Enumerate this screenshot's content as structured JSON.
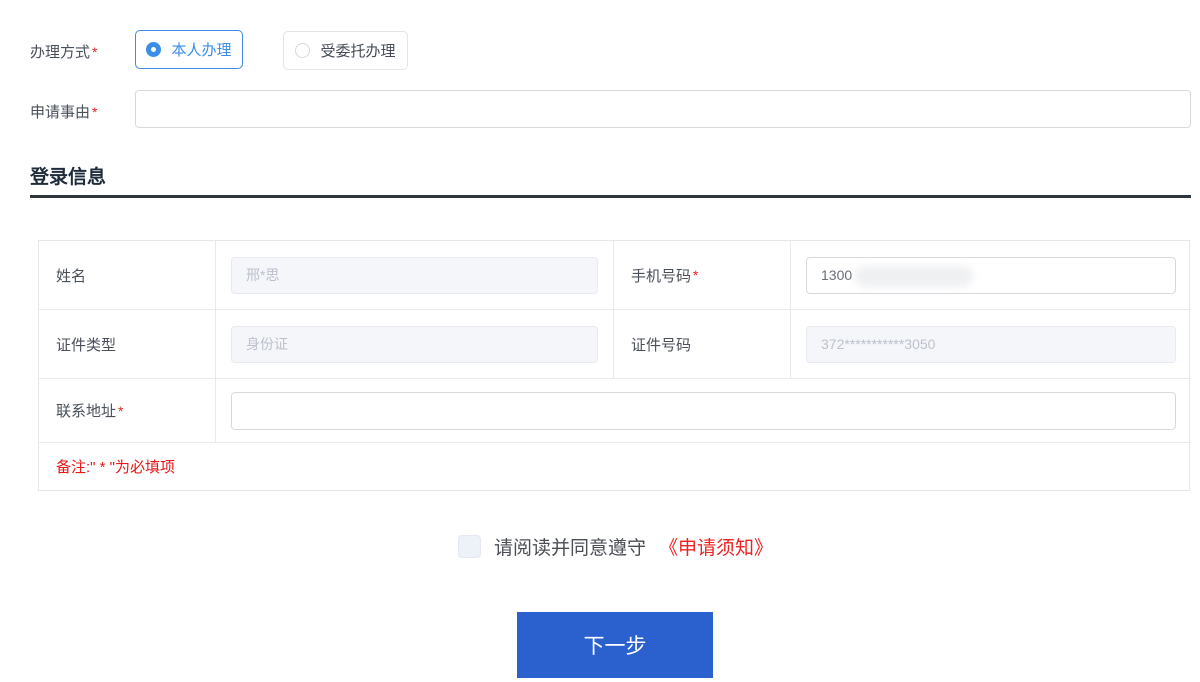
{
  "colors": {
    "accent_blue": "#3a8ee6",
    "button_blue": "#2b61ce",
    "required_red": "#ed1f1f",
    "note_red": "#e81717",
    "heading_dark": "#1f2b3a"
  },
  "method": {
    "label": "办理方式",
    "required_mark": "*",
    "options": [
      {
        "label": "本人办理",
        "selected": true
      },
      {
        "label": "受委托办理",
        "selected": false
      }
    ]
  },
  "reason": {
    "label": "申请事由",
    "required_mark": "*",
    "value": "",
    "placeholder": ""
  },
  "section": {
    "title": "登录信息"
  },
  "info_table": {
    "name": {
      "label": "姓名",
      "value": "邢*思"
    },
    "phone": {
      "label": "手机号码",
      "required_mark": "*",
      "value": "1300"
    },
    "id_type": {
      "label": "证件类型",
      "value": "身份证"
    },
    "id_number": {
      "label": "证件号码",
      "value": "372***********3050"
    },
    "address": {
      "label": "联系地址",
      "required_mark": "*",
      "value": "",
      "placeholder": ""
    },
    "note": "备注:\" * \"为必填项"
  },
  "agreement": {
    "text": "请阅读并同意遵守",
    "link": "《申请须知》",
    "checked": false
  },
  "next_button": {
    "label": "下一步"
  }
}
